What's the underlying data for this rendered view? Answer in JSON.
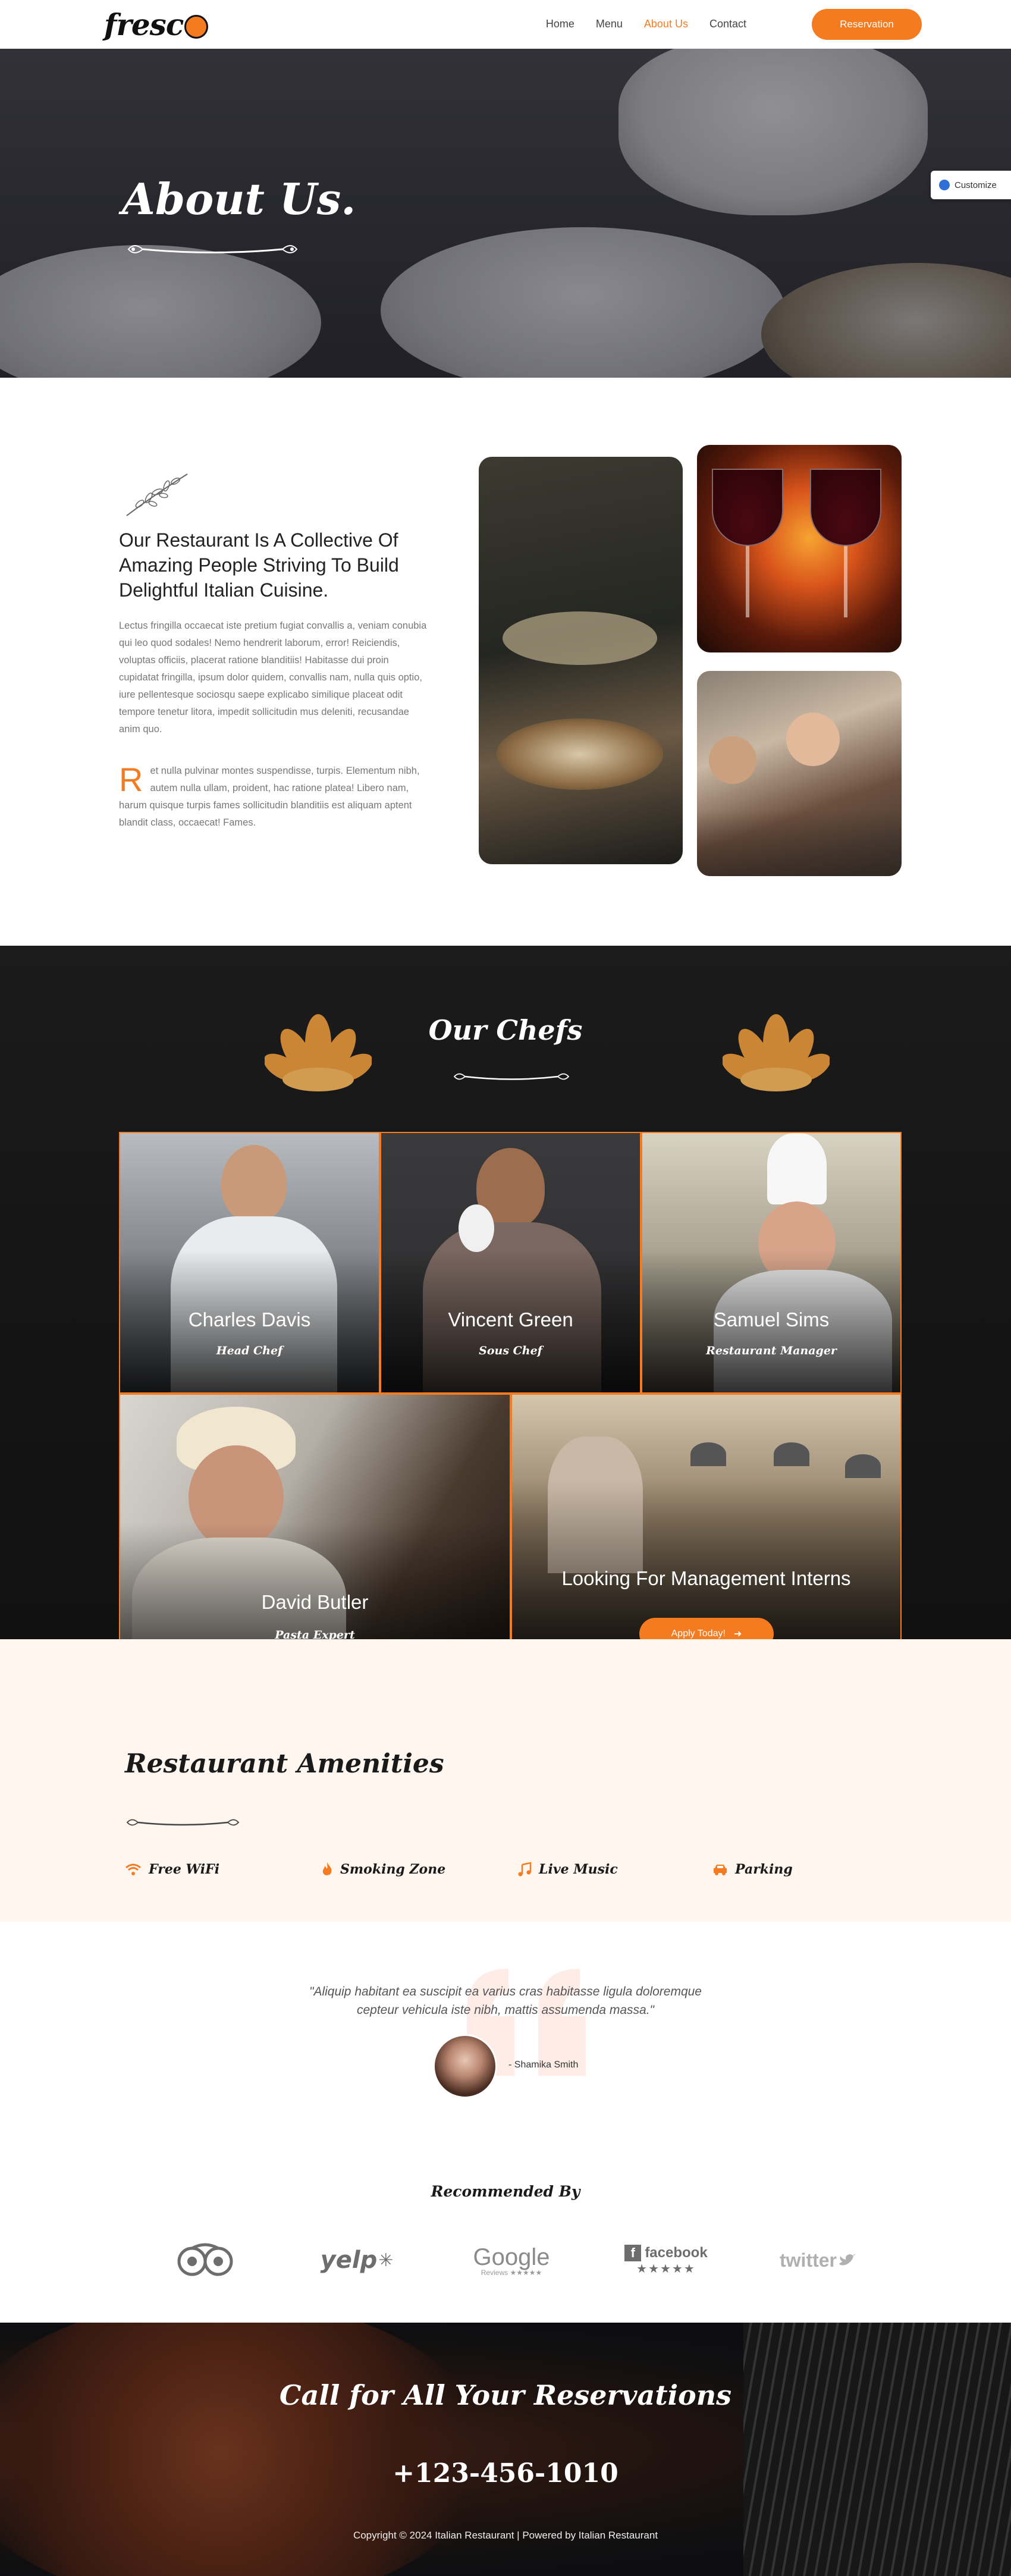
{
  "brand": {
    "logo_text": "fresc",
    "accent_color": "#f47b20"
  },
  "nav": {
    "items": [
      {
        "label": "Home"
      },
      {
        "label": "Menu"
      },
      {
        "label": "About Us",
        "active": true
      },
      {
        "label": "Contact"
      }
    ],
    "reservation_label": "Reservation"
  },
  "hero": {
    "title": "About Us.",
    "customize_label": "Customize"
  },
  "about": {
    "heading": "Our Restaurant Is A Collective Of Amazing People Striving To Build Delightful Italian Cuisine.",
    "paragraph1": "Lectus fringilla occaecat iste pretium fugiat convallis a, veniam conubia qui leo quod sodales! Nemo hendrerit laborum, error! Reiciendis, voluptas officiis, placerat ratione blanditiis! Habitasse dui proin cupidatat fringilla, ipsum dolor quidem, convallis nam, nulla quis optio, iure pellentesque sociosqu saepe explicabo similique placeat odit tempore tenetur litora, impedit sollicitudin mus deleniti, recusandae anim quo.",
    "paragraph2_dropcap": "R",
    "paragraph2": "et nulla pulvinar montes suspendisse, turpis. Elementum nibh, autem nulla ullam, proident, hac ratione platea! Libero nam, harum quisque turpis fames sollicitudin blanditiis est aliquam aptent blandit class, occaecat! Fames."
  },
  "chefs": {
    "title": "Our Chefs",
    "members": [
      {
        "name": "Charles Davis",
        "role": "Head Chef"
      },
      {
        "name": "Vincent Green",
        "role": "Sous Chef"
      },
      {
        "name": "Samuel Sims",
        "role": "Restaurant Manager"
      },
      {
        "name": "David Butler",
        "role": "Pasta Expert"
      }
    ],
    "interns_title": "Looking For Management Interns",
    "apply_label": "Apply Today!"
  },
  "amenities": {
    "title": "Restaurant Amenities",
    "items": [
      {
        "label": "Free WiFi",
        "icon": "wifi-icon"
      },
      {
        "label": "Smoking Zone",
        "icon": "fire-icon"
      },
      {
        "label": "Live Music",
        "icon": "music-icon"
      },
      {
        "label": "Parking",
        "icon": "car-icon"
      }
    ]
  },
  "testimonial": {
    "quote_line1": "\"Aliquip habitant ea suscipit ea varius cras habitasse ligula doloremque",
    "quote_line2": "cepteur vehicula iste nibh, mattis assumenda massa.\"",
    "author": "- Shamika Smith"
  },
  "recommended": {
    "title": "Recommended By",
    "brands": [
      {
        "name": "tripadvisor-logo"
      },
      {
        "name": "yelp",
        "text": "yelp"
      },
      {
        "name": "google-reviews",
        "text": "Google",
        "sub": "Reviews ★★★★★"
      },
      {
        "name": "facebook",
        "text": "facebook",
        "sub": "★★★★★"
      },
      {
        "name": "twitter",
        "text": "twitter"
      }
    ]
  },
  "footer": {
    "title": "Call for All Your Reservations",
    "phone": "+123-456-1010",
    "copyright": "Copyright © 2024 Italian Restaurant | Powered by Italian Restaurant"
  }
}
